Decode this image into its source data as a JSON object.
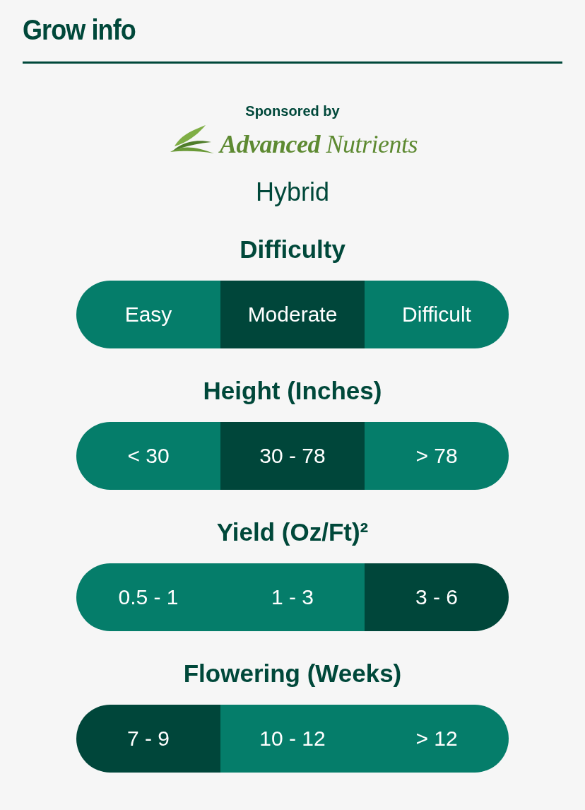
{
  "title": "Grow info",
  "sponsor": {
    "label": "Sponsored by",
    "logo_text": "**Advanced** Nutrients"
  },
  "type": "Hybrid",
  "groups": [
    {
      "heading": "Difficulty",
      "options": [
        {
          "label": "Easy",
          "selected": false
        },
        {
          "label": "Moderate",
          "selected": true
        },
        {
          "label": "Difficult",
          "selected": false
        }
      ]
    },
    {
      "heading": "Height (Inches)",
      "options": [
        {
          "label": "< 30",
          "selected": false
        },
        {
          "label": "30 - 78",
          "selected": true
        },
        {
          "label": "> 78",
          "selected": false
        }
      ]
    },
    {
      "heading": "Yield (Oz/Ft)²",
      "options": [
        {
          "label": "0.5 - 1",
          "selected": false
        },
        {
          "label": "1 - 3",
          "selected": false
        },
        {
          "label": "3 - 6",
          "selected": true
        }
      ]
    },
    {
      "heading": "Flowering (Weeks)",
      "options": [
        {
          "label": "7 - 9",
          "selected": true
        },
        {
          "label": "10 - 12",
          "selected": false
        },
        {
          "label": "> 12",
          "selected": false
        }
      ]
    }
  ]
}
